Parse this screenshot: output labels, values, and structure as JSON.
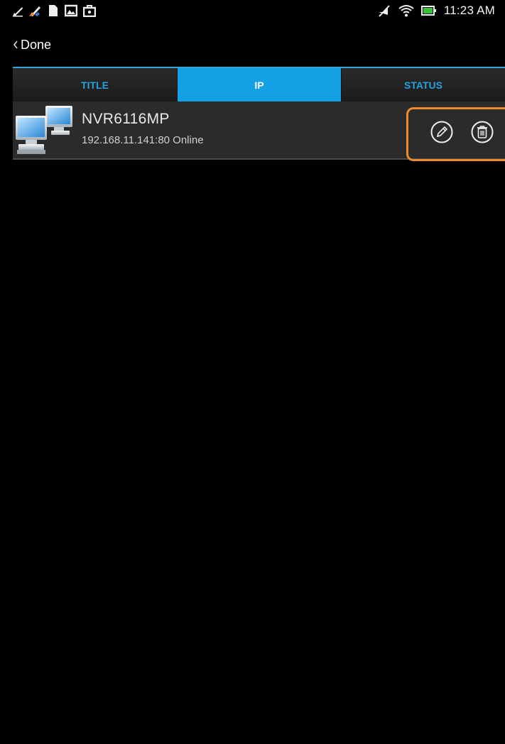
{
  "status_bar": {
    "time": "11:23 AM",
    "icons": [
      "brush-icon",
      "broom-icon",
      "document-icon",
      "image-icon",
      "shopping-bag-icon",
      "mute-icon",
      "wifi-icon",
      "battery-icon"
    ]
  },
  "header": {
    "back_label": "Done"
  },
  "tabs": [
    {
      "label": "TITLE",
      "active": false
    },
    {
      "label": "IP",
      "active": true
    },
    {
      "label": "STATUS",
      "active": false
    }
  ],
  "devices": [
    {
      "name": "NVR6116MP",
      "address": "192.168.11.141:80 Online",
      "icon": "computer-network-icon",
      "actions": [
        "edit-icon",
        "trash-icon"
      ]
    }
  ],
  "colors": {
    "accent": "#14a0e4",
    "tab_text": "#27a3e0",
    "highlight": "#ef8a2e",
    "background": "#000000",
    "row_background": "#2b2b2b"
  }
}
